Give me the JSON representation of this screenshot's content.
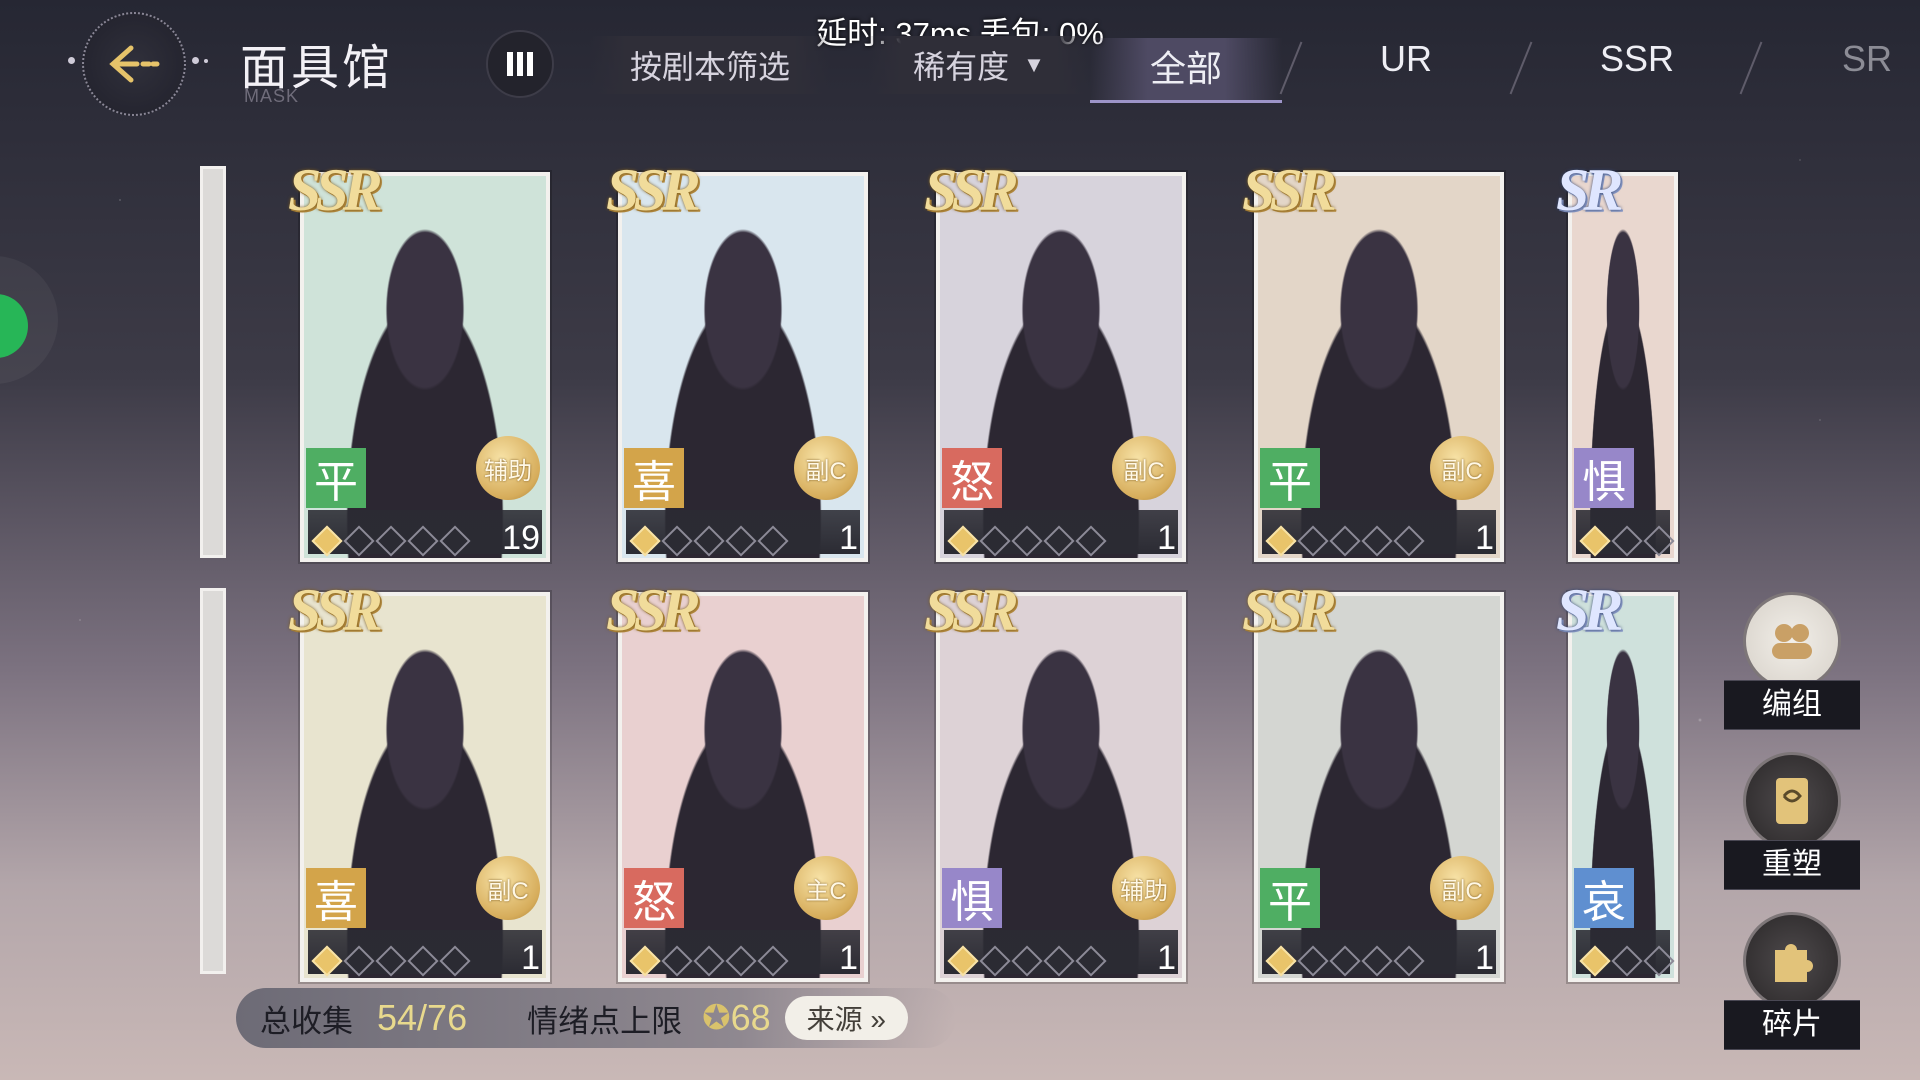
{
  "header": {
    "title": "面具馆",
    "subtitle": "MASK",
    "net_status": "延时: 37ms 丢包: 0%",
    "filter_script": "按剧本筛选",
    "filter_rarity": "稀有度",
    "caret": "▼"
  },
  "tabs": [
    {
      "label": "全部",
      "active": true
    },
    {
      "label": "UR",
      "active": false
    },
    {
      "label": "SSR",
      "active": false
    },
    {
      "label": "SR",
      "active": false
    }
  ],
  "cards": [
    {
      "rank": "SSR",
      "emotion": "平",
      "role": "辅助",
      "count": "19",
      "stars": 1,
      "color": "#cfe3d9"
    },
    {
      "rank": "SSR",
      "emotion": "喜",
      "role": "副C",
      "count": "1",
      "stars": 1,
      "color": "#d9e6ee"
    },
    {
      "rank": "SSR",
      "emotion": "怒",
      "role": "副C",
      "count": "1",
      "stars": 1,
      "color": "#d7d3dc"
    },
    {
      "rank": "SSR",
      "emotion": "平",
      "role": "副C",
      "count": "1",
      "stars": 1,
      "color": "#e3d6c8"
    },
    {
      "rank": "SR",
      "emotion": "惧",
      "role": "",
      "count": "",
      "stars": 1,
      "color": "#e9d7cf"
    },
    {
      "rank": "SSR",
      "emotion": "喜",
      "role": "副C",
      "count": "1",
      "stars": 1,
      "color": "#e8e4cf"
    },
    {
      "rank": "SSR",
      "emotion": "怒",
      "role": "主C",
      "count": "1",
      "stars": 1,
      "color": "#e9d0d0"
    },
    {
      "rank": "SSR",
      "emotion": "惧",
      "role": "辅助",
      "count": "1",
      "stars": 1,
      "color": "#ddd2d6"
    },
    {
      "rank": "SSR",
      "emotion": "平",
      "role": "副C",
      "count": "1",
      "stars": 1,
      "color": "#d4d6d2"
    },
    {
      "rank": "SR",
      "emotion": "哀",
      "role": "",
      "count": "",
      "stars": 1,
      "color": "#cfe1dc"
    }
  ],
  "emotion_colors": {
    "平": "#4fae63",
    "喜": "#d3a44a",
    "怒": "#d86a5f",
    "惧": "#9787c9",
    "哀": "#5f8fd0"
  },
  "side_buttons": [
    {
      "label": "编组",
      "icon": "group-icon"
    },
    {
      "label": "重塑",
      "icon": "card-icon"
    },
    {
      "label": "碎片",
      "icon": "puzzle-icon"
    }
  ],
  "footer": {
    "collection_label": "总收集",
    "collection_value": "54/76",
    "emotion_label": "情绪点上限",
    "emotion_value": "68",
    "source_label": "来源 »"
  }
}
